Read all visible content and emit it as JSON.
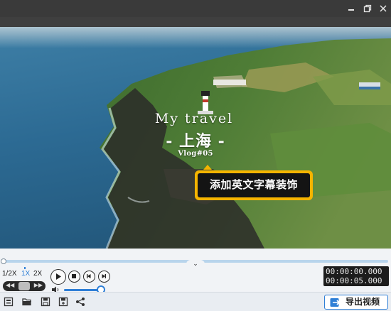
{
  "overlay": {
    "line1": "My travel",
    "line2": "- 上海 -",
    "line3": "Vlog#05"
  },
  "tooltip": {
    "text": "添加英文字幕装饰"
  },
  "playback": {
    "speeds": [
      "1/2X",
      "1X",
      "2X"
    ],
    "active_speed": "1X",
    "jog_left": "◀◀",
    "jog_right": "▶▶",
    "volume_level": 0.9,
    "progress": 0.0
  },
  "time": {
    "current": "00:00:00.000",
    "total": "00:00:05.000"
  },
  "toolbar": {
    "export_label": "导出视频",
    "tools": [
      "subtitle-icon",
      "folder-open-icon",
      "save-icon",
      "save-as-icon",
      "share-icon"
    ]
  },
  "colors": {
    "accent": "#2f7fd6",
    "tooltip_border": "#f5b400",
    "tooltip_bg": "#141414"
  }
}
